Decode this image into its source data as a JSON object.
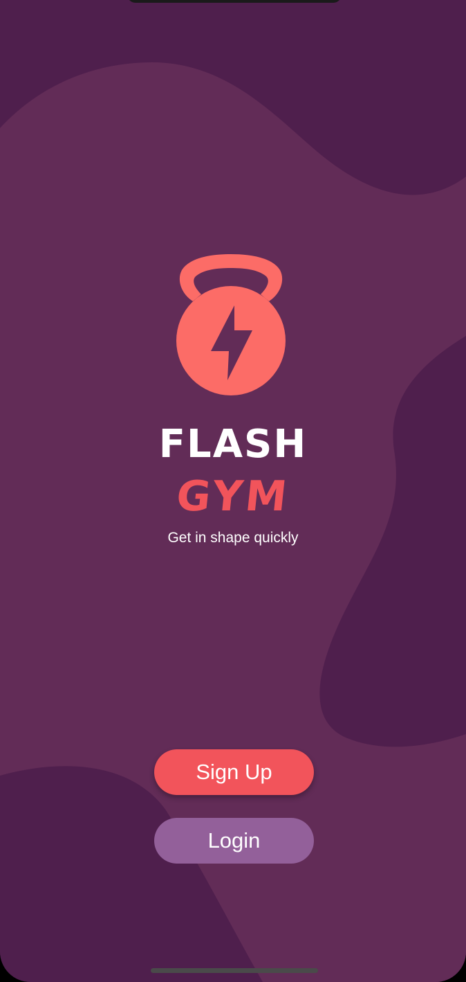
{
  "app": {
    "name_line1": "FLASH",
    "name_line2": "GYM",
    "tagline": "Get in shape quickly"
  },
  "actions": {
    "signup_label": "Sign Up",
    "login_label": "Login"
  },
  "icons": {
    "logo": "kettlebell-lightning-icon"
  },
  "colors": {
    "background_dark": "#4f1f4d",
    "background_light": "#622c57",
    "accent": "#f2545b",
    "logo": "#fc6c67",
    "login_button": "#93609a",
    "text": "#ffffff"
  }
}
